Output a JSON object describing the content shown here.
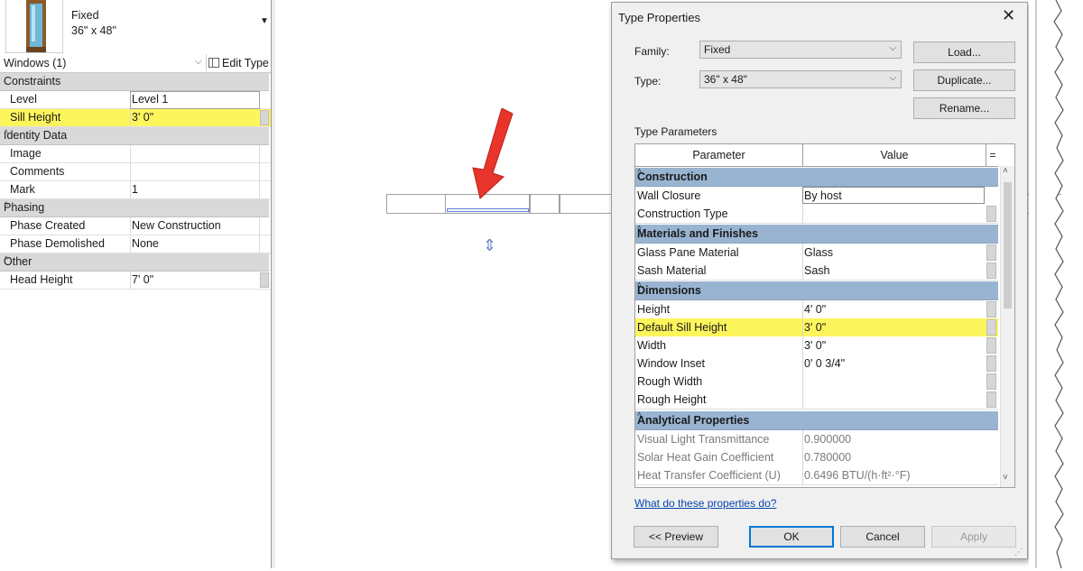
{
  "properties": {
    "type_selector": {
      "family": "Fixed",
      "size": "36\" x 48\""
    },
    "instance_label": "Windows (1)",
    "edit_type_label": "Edit Type",
    "groups": {
      "constraints": "Constraints",
      "identity": "Identity Data",
      "phasing": "Phasing",
      "other": "Other"
    },
    "rows": {
      "level": {
        "name": "Level",
        "value": "Level 1"
      },
      "sill_height": {
        "name": "Sill Height",
        "value": "3'  0\""
      },
      "image": {
        "name": "Image",
        "value": ""
      },
      "comments": {
        "name": "Comments",
        "value": ""
      },
      "mark": {
        "name": "Mark",
        "value": "1"
      },
      "phase_created": {
        "name": "Phase Created",
        "value": "New Construction"
      },
      "phase_demolished": {
        "name": "Phase Demolished",
        "value": "None"
      },
      "head_height": {
        "name": "Head Height",
        "value": "7'  0\""
      }
    }
  },
  "dialog": {
    "title": "Type Properties",
    "family_label": "Family:",
    "family_value": "Fixed",
    "type_label": "Type:",
    "type_value": "36\" x 48\"",
    "load_button": "Load...",
    "duplicate_button": "Duplicate...",
    "rename_button": "Rename...",
    "type_parameters_label": "Type Parameters",
    "grid_headers": {
      "parameter": "Parameter",
      "value": "Value",
      "eq": "="
    },
    "groups": {
      "construction": "Construction",
      "materials": "Materials and Finishes",
      "dimensions": "Dimensions",
      "analytical": "Analytical Properties"
    },
    "rows": {
      "wall_closure": {
        "name": "Wall Closure",
        "value": "By host"
      },
      "construction_type": {
        "name": "Construction Type",
        "value": ""
      },
      "glass_pane": {
        "name": "Glass Pane Material",
        "value": "Glass"
      },
      "sash": {
        "name": "Sash Material",
        "value": "Sash"
      },
      "height": {
        "name": "Height",
        "value": "4'  0\""
      },
      "default_sill": {
        "name": "Default Sill Height",
        "value": "3'  0\""
      },
      "width": {
        "name": "Width",
        "value": "3'  0\""
      },
      "window_inset": {
        "name": "Window Inset",
        "value": "0'  0 3/4\""
      },
      "rough_width": {
        "name": "Rough Width",
        "value": ""
      },
      "rough_height": {
        "name": "Rough Height",
        "value": ""
      },
      "vlt": {
        "name": "Visual Light Transmittance",
        "value": "0.900000"
      },
      "shgc": {
        "name": "Solar Heat Gain Coefficient",
        "value": "0.780000"
      },
      "u_value": {
        "name": "Heat Transfer Coefficient (U)",
        "value": "0.6496 BTU/(h·ft²·°F)"
      }
    },
    "help_link": "What do these properties do?",
    "preview_button": "<< Preview",
    "ok_button": "OK",
    "cancel_button": "Cancel",
    "apply_button": "Apply"
  },
  "colors": {
    "highlight": "#fdf55c",
    "group_header": "#99b4d1",
    "arrow": "#e8352b",
    "link": "#0645ad"
  }
}
